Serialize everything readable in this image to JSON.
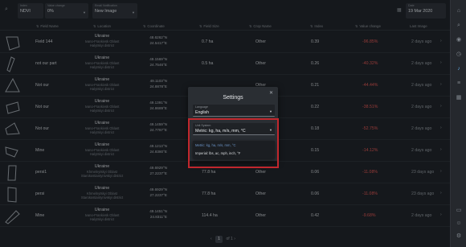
{
  "colors": {
    "accent_red": "#c1272d",
    "negative": "#e0534f",
    "link_blue": "#6b93c6"
  },
  "topbar": {
    "index": {
      "label": "Index",
      "value": "NDVI"
    },
    "value_change": {
      "label": "Value change",
      "value": "0%"
    },
    "email_notification": {
      "label": "Email Notification",
      "value": "New Image"
    },
    "date": {
      "label": "Date",
      "value": "19 Mar 2020"
    }
  },
  "columns": [
    "Field Name",
    "Location",
    "Coordinate",
    "Field Size",
    "Crop Name",
    "Index",
    "Value change",
    "Last Image"
  ],
  "rows": [
    {
      "name": "Field 144",
      "country": "Ukraine",
      "region": "Ivano-Frankivsk Oblast",
      "district": "Halytskyi district",
      "lat": "48.6262°N",
      "lon": "24.5417°E",
      "size": "0.7 ha",
      "crop": "Other",
      "index": "0.39",
      "change": "-96.85%",
      "last": "2 days ago"
    },
    {
      "name": "not our part",
      "country": "Ukraine",
      "region": "Ivano-Frankivsk Oblast",
      "district": "Halytskyi district",
      "lat": "49.1569°N",
      "lon": "24.7546°E",
      "size": "0.5 ha",
      "crop": "Other",
      "index": "0.26",
      "change": "-40.32%",
      "last": "2 days ago"
    },
    {
      "name": "Not our",
      "country": "Ukraine",
      "region": "Ivano-Frankivsk Oblast",
      "district": "Halytskyi district",
      "lat": "49.1103°N",
      "lon": "24.8878°E",
      "size": "",
      "crop": "Other",
      "index": "0.21",
      "change": "-44.44%",
      "last": "2 days ago"
    },
    {
      "name": "Not our",
      "country": "Ukraine",
      "region": "Ivano-Frankivsk Oblast",
      "district": "Halytskyi district",
      "lat": "49.1391°N",
      "lon": "24.8689°E",
      "size": "",
      "crop": "Other",
      "index": "0.22",
      "change": "-38.51%",
      "last": "2 days ago"
    },
    {
      "name": "Not our",
      "country": "Ukraine",
      "region": "Ivano-Frankivsk Oblast",
      "district": "Halytskyi district",
      "lat": "49.1459°N",
      "lon": "24.7787°E",
      "size": "",
      "crop": "Other",
      "index": "0.18",
      "change": "-52.75%",
      "last": "2 days ago"
    },
    {
      "name": "Mine",
      "country": "Ukraine",
      "region": "Ivano-Frankivsk Oblast",
      "district": "Halytskyi district",
      "lat": "49.1213°N",
      "lon": "24.8380°E",
      "size": "",
      "crop": "Other",
      "index": "0.15",
      "change": "-14.12%",
      "last": "2 days ago"
    },
    {
      "name": "persi1",
      "country": "Ukraine",
      "region": "Khmelnytskyi Oblast",
      "district": "Starokostiantynivskyi district",
      "lat": "49.6929°N",
      "lon": "27.2237°E",
      "size": "77.8 ha",
      "crop": "Other",
      "index": "0.06",
      "change": "-11.08%",
      "last": "23 days ago"
    },
    {
      "name": "persi",
      "country": "Ukraine",
      "region": "Khmelnytskyi Oblast",
      "district": "Starokostiantynivskyi district",
      "lat": "49.6929°N",
      "lon": "27.2237°E",
      "size": "77.8 ha",
      "crop": "Other",
      "index": "0.06",
      "change": "-11.08%",
      "last": "23 days ago"
    },
    {
      "name": "Mine",
      "country": "Ukraine",
      "region": "Ivano-Frankivsk Oblast",
      "district": "Halytskyi district",
      "lat": "49.1451°N",
      "lon": "24.8311°E",
      "size": "114.4 ha",
      "crop": "Other",
      "index": "0.42",
      "change": "-9.68%",
      "last": "2 days ago"
    }
  ],
  "pager": {
    "current": "1",
    "of_label": "of",
    "total": "1"
  },
  "settings": {
    "title": "Settings",
    "language": {
      "label": "Language",
      "value": "English"
    },
    "unit_system": {
      "label": "Unit System",
      "value": "Metric: kg, ha, m/s, mm, °C"
    },
    "options": [
      "Metric: kg, ha, m/s, mm, °C",
      "Imperial: lbs, ac, mph, inch, °F"
    ]
  },
  "icons": [
    "search-icon",
    "calendar-icon",
    "home-icon",
    "location-icon",
    "clock-icon",
    "bell-icon",
    "list-icon",
    "grid-icon",
    "chat-icon",
    "user-icon",
    "settings-icon",
    "close-icon"
  ]
}
